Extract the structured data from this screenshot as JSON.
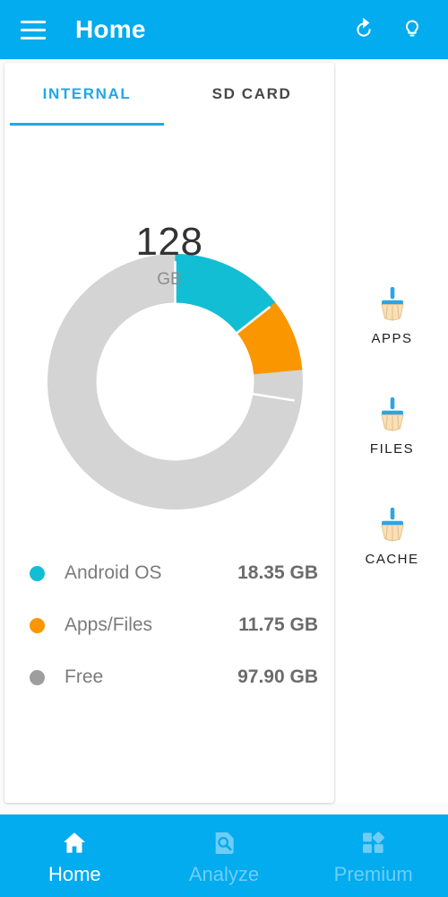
{
  "appbar": {
    "menu_icon": "hamburger-menu-icon",
    "title": "Home",
    "refresh_icon": "refresh-icon",
    "tip_icon": "lightbulb-icon"
  },
  "tabs": [
    {
      "label": "INTERNAL",
      "active": true
    },
    {
      "label": "SD CARD",
      "active": false
    }
  ],
  "storage": {
    "center_value": "128",
    "center_unit": "GB"
  },
  "legend": [
    {
      "label": "Android OS",
      "value": "18.35 GB",
      "color": "#12bed4"
    },
    {
      "label": "Apps/Files",
      "value": "11.75 GB",
      "color": "#fa9600"
    },
    {
      "label": "Free",
      "value": "97.90 GB",
      "color": "#9e9e9e"
    }
  ],
  "actions": [
    {
      "label": "APPS",
      "icon": "broom-icon"
    },
    {
      "label": "FILES",
      "icon": "broom-icon"
    },
    {
      "label": "CACHE",
      "icon": "broom-icon"
    }
  ],
  "bottom_nav": [
    {
      "label": "Home",
      "icon": "home-icon",
      "active": true
    },
    {
      "label": "Analyze",
      "icon": "document-search-icon",
      "active": false
    },
    {
      "label": "Premium",
      "icon": "premium-blocks-icon",
      "active": false
    }
  ],
  "colors": {
    "accent": "#03abef",
    "android_os": "#12bed4",
    "apps_files": "#fa9600",
    "free": "#d4d4d4",
    "tab_active": "#20a7ea"
  },
  "chart_data": {
    "type": "pie",
    "title": "Internal storage usage",
    "total": 128,
    "total_unit": "GB",
    "center_label": "128",
    "center_sublabel": "GB",
    "labels": [
      "Android OS",
      "Apps/Files",
      "Free"
    ],
    "values": [
      18.35,
      11.75,
      97.9
    ],
    "value_labels": [
      "18.35 GB",
      "11.75 GB",
      "97.90 GB"
    ],
    "colors": [
      "#12bed4",
      "#fa9600",
      "#d4d4d4"
    ],
    "units": "GB",
    "donut": true,
    "inner_radius_ratio": 0.62,
    "start_angle_deg": 0,
    "direction": "clockwise",
    "legend_position": "below"
  }
}
